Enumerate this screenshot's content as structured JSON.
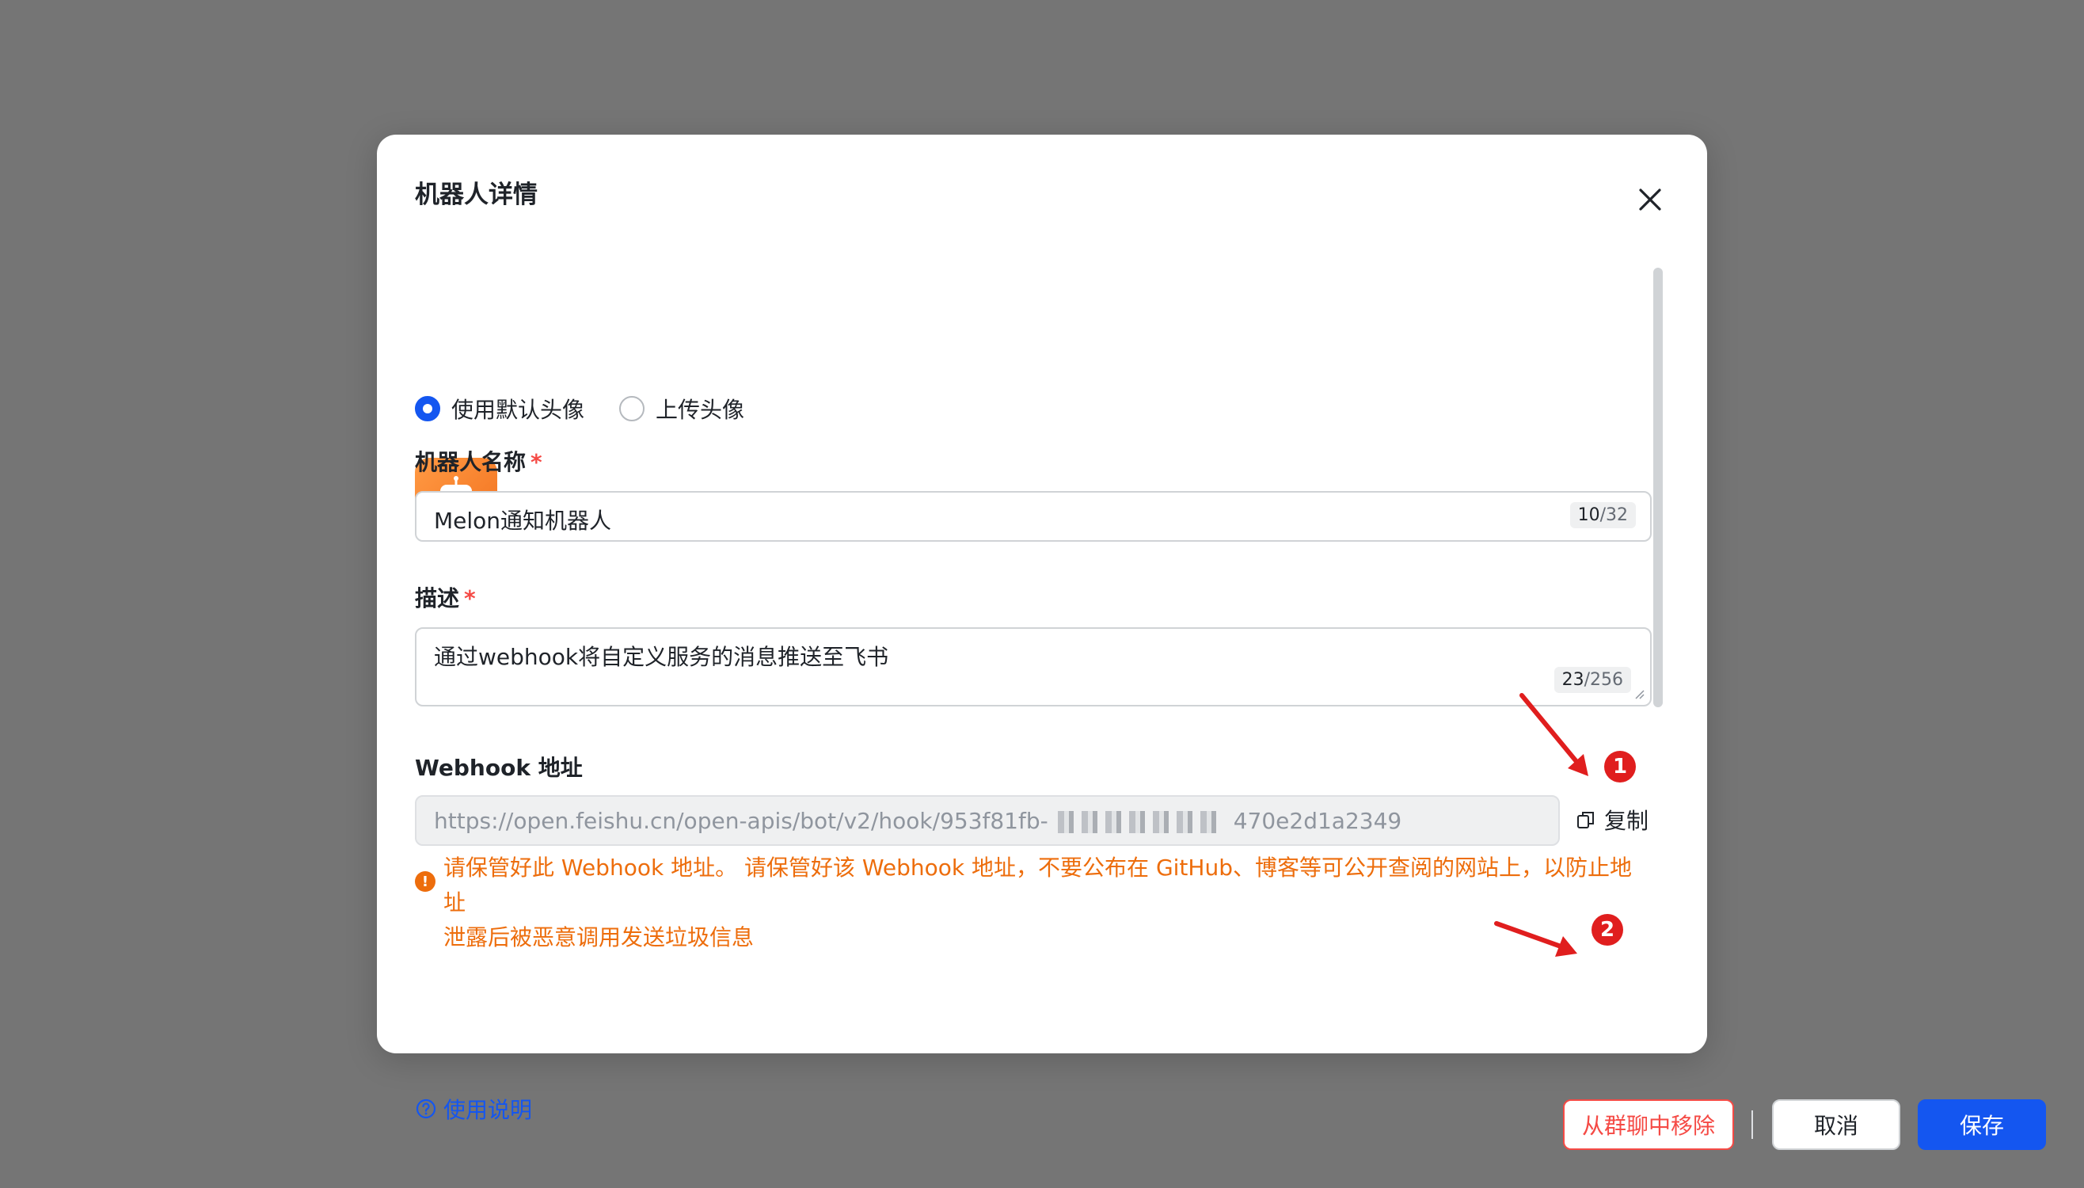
{
  "dialog": {
    "title": "机器人详情"
  },
  "avatar_mode": {
    "options": [
      {
        "label": "使用默认头像",
        "checked": true
      },
      {
        "label": "上传头像",
        "checked": false
      }
    ]
  },
  "avatar": {
    "icon": "robot-icon",
    "bg_color": "#f2701d"
  },
  "swatches": [
    "#3370ff",
    "#7f3bf5",
    "#14b8a6",
    "#2ea121",
    "#8fac02",
    "#dc9b04",
    "#de7802",
    "#f01d94"
  ],
  "name_field": {
    "label": "机器人名称",
    "required_mark": "*",
    "value": "Melon通知机器人",
    "count_current": "10",
    "count_max": "/32"
  },
  "desc_field": {
    "label": "描述",
    "required_mark": "*",
    "value": "通过webhook将自定义服务的消息推送至飞书",
    "count_current": "23",
    "count_max": "/256"
  },
  "webhook": {
    "label": "Webhook 地址",
    "url_prefix": "https://open.feishu.cn/open-apis/bot/v2/hook/953f81fb-",
    "url_suffix": "470e2d1a2349",
    "copy_label": "复制",
    "warning_line1": "请保管好此 Webhook 地址。 请保管好该 Webhook 地址，不要公布在 GitHub、博客等可公开查阅的网站上，以防止地址",
    "warning_line2": "泄露后被恶意调用发送垃圾信息"
  },
  "footer": {
    "help_label": "使用说明",
    "remove_label": "从群聊中移除",
    "cancel_label": "取消",
    "save_label": "保存"
  },
  "annotations": {
    "badge1": "1",
    "badge2": "2",
    "color": "#e01e1e"
  }
}
